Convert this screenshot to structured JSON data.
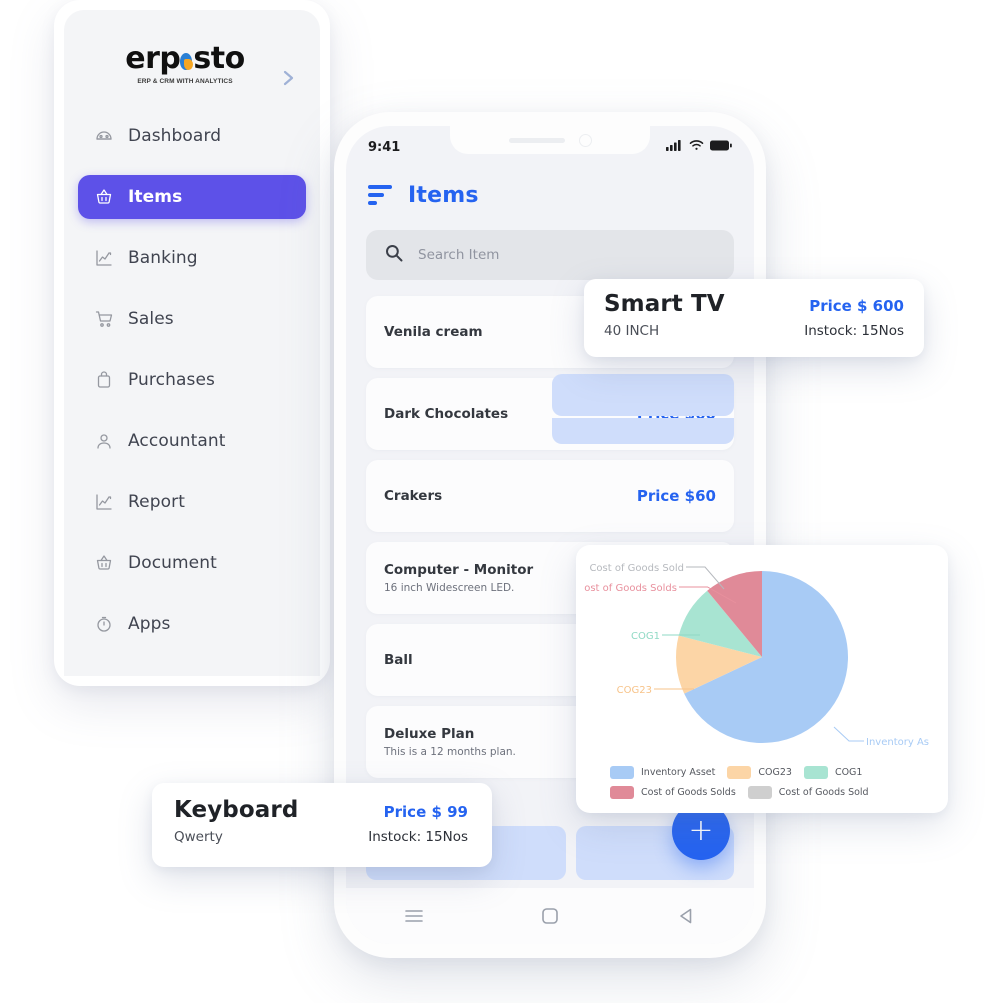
{
  "sidebar": {
    "logo": {
      "text_left": "erp",
      "text_right": "sto",
      "tagline": "ERP & CRM WITH ANALYTICS"
    },
    "expand_icon": "chevron-right-icon",
    "items": [
      {
        "label": "Dashboard",
        "icon": "dashboard-icon",
        "active": false
      },
      {
        "label": "Items",
        "icon": "basket-icon",
        "active": true
      },
      {
        "label": "Banking",
        "icon": "chart-line-icon",
        "active": false
      },
      {
        "label": "Sales",
        "icon": "cart-icon",
        "active": false
      },
      {
        "label": "Purchases",
        "icon": "bag-icon",
        "active": false
      },
      {
        "label": "Accountant",
        "icon": "user-icon",
        "active": false
      },
      {
        "label": "Report",
        "icon": "chart-line-icon",
        "active": false
      },
      {
        "label": "Document",
        "icon": "basket-icon",
        "active": false
      },
      {
        "label": "Apps",
        "icon": "clock-icon",
        "active": false
      }
    ],
    "active_color": "#5d51e8"
  },
  "phone": {
    "status": {
      "time": "9:41",
      "signal_icon": "cellular-signal-icon",
      "wifi_icon": "wifi-icon",
      "battery_icon": "battery-full-icon"
    },
    "header": {
      "menu_icon": "hamburger-menu-icon",
      "title": "Items",
      "title_color": "#2563f0"
    },
    "search": {
      "icon": "search-icon",
      "placeholder": "Search Item",
      "value": ""
    },
    "items": [
      {
        "name": "Venila cream",
        "desc": "",
        "price": ""
      },
      {
        "name": "Dark Chocolates",
        "desc": "",
        "price": "Price $60"
      },
      {
        "name": "Crakers",
        "desc": "",
        "price": "Price $60"
      },
      {
        "name": "Computer - Monitor",
        "desc": "16 inch Widescreen LED.",
        "price": ""
      },
      {
        "name": "Ball",
        "desc": "",
        "price": ""
      },
      {
        "name": "Deluxe Plan",
        "desc": "This is a 12 months plan.",
        "price": ""
      }
    ],
    "fab": {
      "icon": "plus-icon",
      "label": "+",
      "color": "#2563f0"
    },
    "navbar": [
      {
        "icon": "menu-lines-icon"
      },
      {
        "icon": "home-square-icon"
      },
      {
        "icon": "back-triangle-icon"
      }
    ]
  },
  "cards": {
    "smart_tv": {
      "title": "Smart TV",
      "subtitle": "40 INCH",
      "price": "Price $ 600",
      "stock": "Instock: 15Nos"
    },
    "keyboard": {
      "title": "Keyboard",
      "subtitle": "Qwerty",
      "price": "Price $ 99",
      "stock": "Instock: 15Nos"
    }
  },
  "chart_data": {
    "type": "pie",
    "title": "",
    "categories": [
      "Inventory Asset",
      "COG23",
      "COG1",
      "Cost of Goods Solds",
      "Cost of Goods Sold"
    ],
    "values": [
      68,
      11,
      10,
      11,
      0
    ],
    "colors": [
      "#a8cbf5",
      "#fcd5a6",
      "#a8e4d2",
      "#e08a98",
      "#cfcfcf"
    ],
    "legend_position": "bottom",
    "annotations": [
      {
        "label": "Cost of Goods Sold",
        "color": "#b6b9be"
      },
      {
        "label": "ost of Goods Solds",
        "color": "#e8909d"
      },
      {
        "label": "COG1",
        "color": "#8fd9c4"
      },
      {
        "label": "COG23",
        "color": "#f7c389"
      },
      {
        "label": "Inventory As",
        "color": "#a8cbf5"
      }
    ],
    "legend": [
      {
        "label": "Inventory Asset",
        "color": "#a8cbf5"
      },
      {
        "label": "COG23",
        "color": "#fcd5a6"
      },
      {
        "label": "COG1",
        "color": "#a8e4d2"
      },
      {
        "label": "Cost of Goods Solds",
        "color": "#e08a98"
      },
      {
        "label": "Cost of Goods Sold",
        "color": "#cfcfcf"
      }
    ]
  }
}
